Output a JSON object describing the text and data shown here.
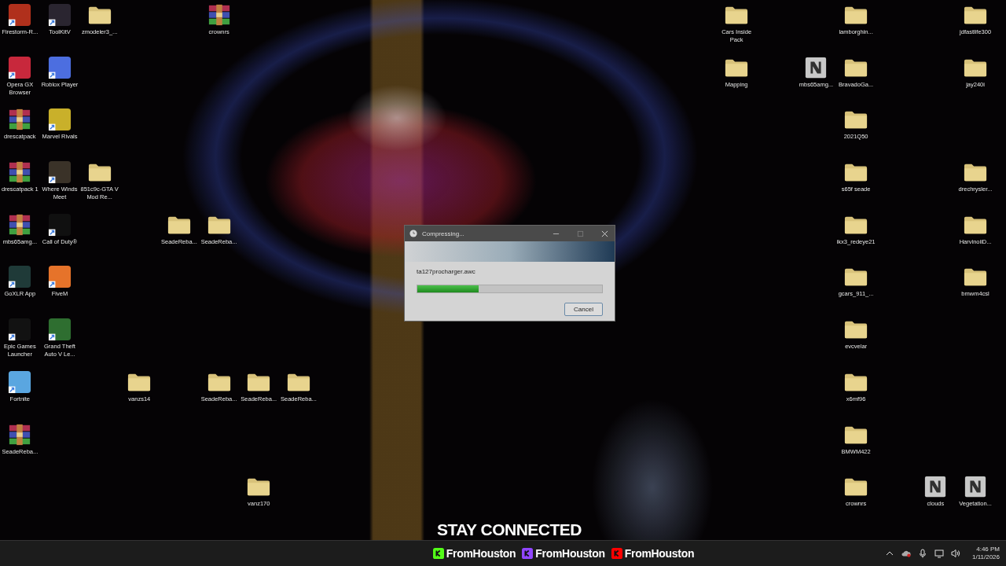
{
  "desktop": {
    "icons": [
      {
        "label": "Firestorm-R...",
        "kind": "app",
        "color": "#b0301c"
      },
      {
        "label": "ToolKitV",
        "kind": "app",
        "color": "#2a2530"
      },
      {
        "label": "zmodeler3_...",
        "kind": "folder"
      },
      {
        "label": "crownrs",
        "kind": "archive"
      },
      {
        "label": "Cars Inside Pack",
        "kind": "folder"
      },
      {
        "label": "lamborghin...",
        "kind": "folder"
      },
      {
        "label": "jdfastlife300",
        "kind": "folder"
      },
      {
        "label": "Opera GX Browser",
        "kind": "app",
        "color": "#c8283c"
      },
      {
        "label": "Roblox Player",
        "kind": "app",
        "color": "#4c6ee0"
      },
      {
        "label": "Mapping",
        "kind": "folder"
      },
      {
        "label": "mbs65amg...",
        "kind": "file"
      },
      {
        "label": "BravadoGa...",
        "kind": "folder"
      },
      {
        "label": "jay240i",
        "kind": "folder"
      },
      {
        "label": "drescatpack",
        "kind": "archive"
      },
      {
        "label": "Marvel Rivals",
        "kind": "app",
        "color": "#c9b02a"
      },
      {
        "label": "2021Q50",
        "kind": "folder"
      },
      {
        "label": "drescatpack 1",
        "kind": "archive"
      },
      {
        "label": "Where Winds Meet",
        "kind": "app",
        "color": "#3a3228"
      },
      {
        "label": "851c9c-GTA V Mod Re...",
        "kind": "folder"
      },
      {
        "label": "s65f seade",
        "kind": "folder"
      },
      {
        "label": "drechrysler...",
        "kind": "folder"
      },
      {
        "label": "mbs65amg...",
        "kind": "archive"
      },
      {
        "label": "Call of Duty®",
        "kind": "app",
        "color": "#101010"
      },
      {
        "label": "SeadeReba...",
        "kind": "folder"
      },
      {
        "label": "SeadeReba...",
        "kind": "folder"
      },
      {
        "label": "ikx3_redeye21",
        "kind": "folder"
      },
      {
        "label": "HarvinoiiD...",
        "kind": "folder"
      },
      {
        "label": "GoXLR App",
        "kind": "app",
        "color": "#1f3a38"
      },
      {
        "label": "FiveM",
        "kind": "app",
        "color": "#e6732a"
      },
      {
        "label": "gcars_911_...",
        "kind": "folder"
      },
      {
        "label": "bmwm4csl",
        "kind": "folder"
      },
      {
        "label": "Epic Games Launcher",
        "kind": "app",
        "color": "#121212"
      },
      {
        "label": "Grand Theft Auto V Le...",
        "kind": "app",
        "color": "#2e6e30"
      },
      {
        "label": "evcvelar",
        "kind": "folder"
      },
      {
        "label": "Fortnite",
        "kind": "app",
        "color": "#5aa6e0"
      },
      {
        "label": "vanzs14",
        "kind": "folder"
      },
      {
        "label": "SeadeReba...",
        "kind": "folder"
      },
      {
        "label": "SeadeReba...",
        "kind": "folder"
      },
      {
        "label": "SeadeReba...",
        "kind": "folder"
      },
      {
        "label": "x6mf96",
        "kind": "folder"
      },
      {
        "label": "SeadeReba...",
        "kind": "archive"
      },
      {
        "label": "BMWM422",
        "kind": "folder"
      },
      {
        "label": "vanz170",
        "kind": "folder"
      },
      {
        "label": "crownrs",
        "kind": "folder"
      },
      {
        "label": "clouds",
        "kind": "file"
      },
      {
        "label": "Vegetation...",
        "kind": "file"
      }
    ]
  },
  "dialog": {
    "title": "Compressing...",
    "file": "ta127procharger.awc",
    "progress": {
      "level": 0.33
    },
    "cancel": "Cancel"
  },
  "overlay": {
    "heading": "STAY CONNECTED",
    "socials": [
      {
        "handle": "FromHouston",
        "color": "#53fc18"
      },
      {
        "handle": "FromHouston",
        "color": "#9146ff"
      },
      {
        "handle": "FromHouston",
        "color": "#ff0000"
      }
    ]
  },
  "taskbar": {
    "time": "4:46 PM",
    "date": "1/11/2026"
  }
}
